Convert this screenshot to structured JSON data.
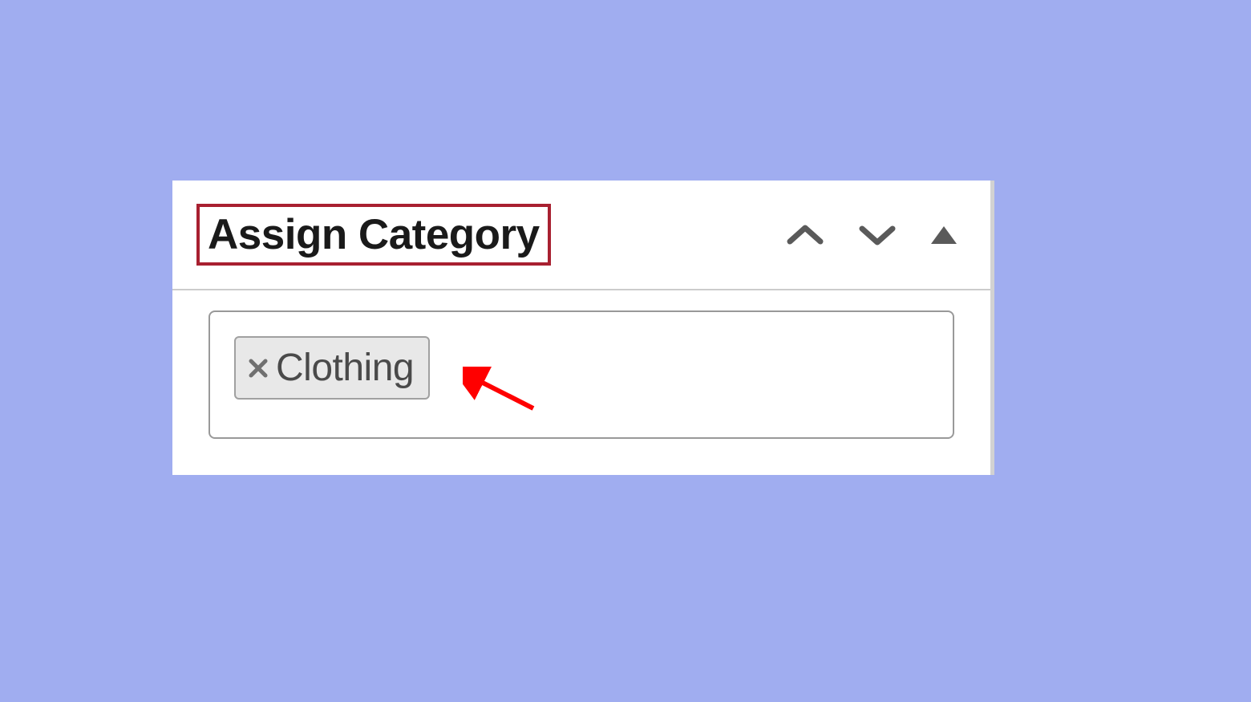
{
  "panel": {
    "title": "Assign Category"
  },
  "tags": [
    {
      "label": "Clothing"
    }
  ],
  "colors": {
    "highlight_box": "#a82030",
    "annotation_arrow": "#ff0000",
    "background": "#a0adf0"
  }
}
